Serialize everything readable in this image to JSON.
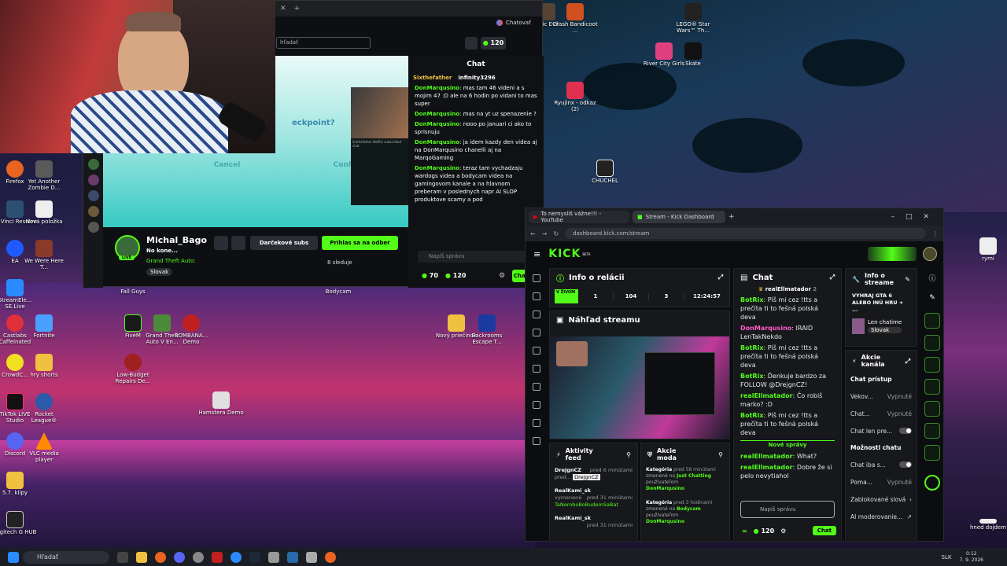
{
  "stream_window": {
    "search_placeholder": "hľadať",
    "tab_label": "Chatovať",
    "viewer_count": "120",
    "chat_title": "Chat",
    "top_gifters": [
      "Sixthefather",
      "infinity3296"
    ],
    "messages": [
      {
        "user": "DonMarqusino",
        "text": "mas tam 46 videni a s mojim 47 :D ale na 6 hodin po vidani to mas super"
      },
      {
        "user": "DonMarqusino",
        "text": "mas na yt uz spenazenie ?"
      },
      {
        "user": "DonMarqusino",
        "text": "nooo po januari ci ako to sprisnuju"
      },
      {
        "user": "DonMarqusino",
        "text": "ja idem kazdy den videa aj na DonMarqusino chanelli aj na MarqoGaming"
      },
      {
        "user": "DonMarqusino",
        "text": "teraz tam vychadzaju wardogs videa a bodycam videa na gamingovom kanale a na hlavnom preberam v poslednych napr AI SLOP produktove scamy a pod"
      }
    ],
    "chat_placeholder": "Napíš správu",
    "points": "70",
    "viewers_bottom": "120",
    "chat_button": "Chat",
    "dialog_text": "eckpoint?",
    "cancel": "Cancel",
    "confirm": "Confirm",
    "streamer": "Michal_Bago",
    "live_badge": "LIVE",
    "notice": "No kone...",
    "game": "Grand Theft Auto:",
    "tag": "Slovak",
    "gift_button": "Darčekové subs",
    "follow_button": "Prihlas sa na odber",
    "followers": "8 sleduje",
    "overlay_lines": [
      "Sixthefather",
      "BotRix",
      "subscribed",
      "chat"
    ]
  },
  "desktop_icons": [
    {
      "label": "Firefox",
      "color": "#e86420"
    },
    {
      "label": "Yet Another Zombie D...",
      "color": "#5a5a5a"
    },
    {
      "label": "DaVinci Resolve",
      "color": "#2b5070"
    },
    {
      "label": "Nová položka",
      "color": "#eeeeee"
    },
    {
      "label": "EA",
      "color": "#1e5aff"
    },
    {
      "label": "We Were Here T...",
      "color": "#8a3a2a"
    },
    {
      "label": "StreamEle... SE.Live",
      "color": "#2a8aff"
    },
    {
      "label": "Castlabs Caffeinated",
      "color": "#e0303a"
    },
    {
      "label": "Fortnite",
      "color": "#4aa0ff"
    },
    {
      "label": "CrowdC...",
      "color": "#f0e020"
    },
    {
      "label": "hry shorts",
      "color": "#f0c040"
    },
    {
      "label": "TikTok LIVE Studio",
      "color": "#111111"
    },
    {
      "label": "Rocket League®",
      "color": "#2a5aaa"
    },
    {
      "label": "Discord",
      "color": "#5865f2"
    },
    {
      "label": "VLC media player",
      "color": "#ff8a00"
    },
    {
      "label": "5.7. klipy",
      "color": "#f0c040"
    },
    {
      "label": "Logitech G HUB",
      "color": "#222222"
    },
    {
      "label": "Fall Guys",
      "color": "#ff6ab0"
    },
    {
      "label": "FiveM",
      "color": "#1a1a1a"
    },
    {
      "label": "Grand Theft Auto V En...",
      "color": "#4a8a3a"
    },
    {
      "label": "BOMBANA... Demo",
      "color": "#c02020"
    },
    {
      "label": "Low-Budget Repairs De...",
      "color": "#a02020"
    },
    {
      "label": "Hamstera Demo",
      "color": "#e0e0e0"
    },
    {
      "label": "Bodycam",
      "color": "#444444"
    },
    {
      "label": "Nový priečinok",
      "color": "#f0c040"
    },
    {
      "label": "Backrooms Escape T...",
      "color": "#1a3aa0"
    },
    {
      "label": "Classic Evil ...",
      "color": "#554433"
    },
    {
      "label": "Crash Bandicoot ...",
      "color": "#d05020"
    },
    {
      "label": "LEGO® Star Wars™ Th...",
      "color": "#222222"
    },
    {
      "label": "River City Girls",
      "color": "#e04080"
    },
    {
      "label": "Skate",
      "color": "#111111"
    },
    {
      "label": "Ryujinx - odkaz (2)",
      "color": "#e03050"
    },
    {
      "label": "CHUCHEL",
      "color": "#222222"
    },
    {
      "label": "rymi",
      "color": "#eeeeee"
    },
    {
      "label": "hned dojdem",
      "color": "#eeeeee"
    }
  ],
  "kick_browser": {
    "tabs": [
      "To nemyslíš vážne!!! - YouTube",
      "Stream - Kick Dashboard"
    ],
    "url": "dashboard.kick.com/stream",
    "logo": "KICK",
    "logo_badge": "BETA",
    "session_title": "Info o relácii",
    "session_stats": [
      "V ŽIVOM",
      "1",
      "104",
      "3",
      "12:24:57"
    ],
    "preview_title": "Náhľad streamu",
    "chat_title": "Chat",
    "pinned_user": "realEllmatador",
    "pinned_count": "2",
    "chat": [
      {
        "user": "BotRix",
        "text": "Píš mi cez !tts a prečíta ti to fešná polská deva"
      },
      {
        "user": "DonMarqusino",
        "text": "IRAID LenTakNekdo",
        "pink": true
      },
      {
        "user": "BotRix",
        "text": "Píš mi cez !tts a prečíta ti to fešná polská deva"
      },
      {
        "user": "BotRix",
        "text": "Ďenkuje bardzo za FOLLOW @DrejgnCZ!"
      },
      {
        "user": "realEllmatador",
        "text": "Čo robiš marko? :D"
      },
      {
        "user": "BotRix",
        "text": "Píš mi cez !tts a prečíta ti to fešná polská deva"
      }
    ],
    "new_messages": "Nové správy",
    "chat_new": [
      {
        "user": "realEllmatador",
        "text": "What?"
      },
      {
        "user": "realEllmatador",
        "text": "Dobre že si pelo nevytiahol"
      }
    ],
    "chat_placeholder": "Napíš správu",
    "chat_points": "120",
    "chat_button": "Chat",
    "activity_title": "Aktivity feed",
    "activity": [
      {
        "user": "DrejgnCZ",
        "time": "pred 6 minútami",
        "detail": "pred...",
        "tooltip": "DrejgnCZ"
      },
      {
        "user": "RealKami_sk",
        "time": "pred 31 minútami",
        "detail": "vymenené",
        "sub": "TaNeroboBoBudemSaBat"
      },
      {
        "user": "RealKami_sk",
        "time": "pred 31 minútami",
        "detail": ""
      }
    ],
    "mod_title": "Akcie moda",
    "mod": [
      {
        "label": "Kategória",
        "time": "pred 58 minútami",
        "text": "zmenené na",
        "value": "Just Chatting",
        "by": "používateľom",
        "who": "DonMarqusino"
      },
      {
        "label": "Kategória",
        "time": "pred 3 hodinami",
        "text": "zmenené na",
        "value": "Bodycam",
        "by": "používateľom",
        "who": "DonMarqusino"
      }
    ],
    "stream_info_title": "Info o streame",
    "stream_info_text": "VYHRAJ GTA 6 ALEBO INÚ HRU + ...",
    "stream_category": "Len chatime",
    "stream_tag": "Slovak",
    "channel_actions_title": "Akcie kanála",
    "chat_access": "Chat prístup",
    "settings": [
      {
        "label": "Vekov...",
        "value": "Vypnuté"
      },
      {
        "label": "Chat...",
        "value": "Vypnuté"
      },
      {
        "label": "Chat len pre...",
        "value": ""
      }
    ],
    "chat_options": "Možnosti chatu",
    "options": [
      {
        "label": "Chat iba s...",
        "value": ""
      },
      {
        "label": "Poma...",
        "value": "Vypnuté"
      },
      {
        "label": "Zablokované slová",
        "value": ""
      },
      {
        "label": "AI moderovanie...",
        "value": ""
      }
    ]
  },
  "taskbar": {
    "search": "Hľadať",
    "lang": "SLK",
    "time": "0:12",
    "date": "7. 9. 2026"
  }
}
